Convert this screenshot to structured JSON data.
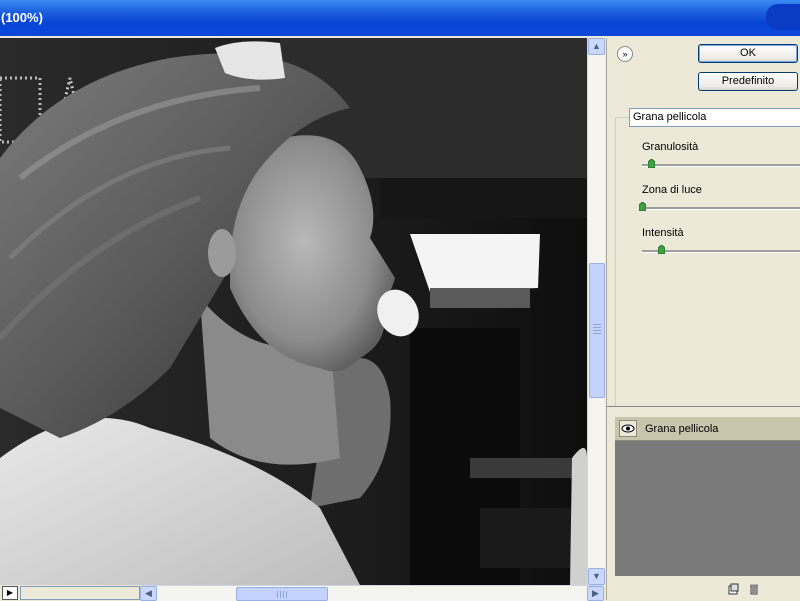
{
  "window": {
    "title": "(100%)"
  },
  "buttons": {
    "ok": "OK",
    "default": "Predefinito"
  },
  "collapse_icon": "double-chevron-down-icon",
  "filter": {
    "selected": "Grana pellicola"
  },
  "sliders": [
    {
      "label": "Granulosità",
      "level": 0.07
    },
    {
      "label": "Zona di luce",
      "level": 0.0
    },
    {
      "label": "Intensità",
      "level": 0.12
    }
  ],
  "layers": [
    {
      "name": "Grana pellicola",
      "icon": "eye-icon"
    }
  ],
  "bottom_icons": [
    "new-layer-icon",
    "trash-icon"
  ],
  "colors": {
    "titlebar": "#0A46D6",
    "panel": "#ECE9D8",
    "layer_row": "#C8C5AC",
    "layers_bg": "#7A7A7A"
  }
}
